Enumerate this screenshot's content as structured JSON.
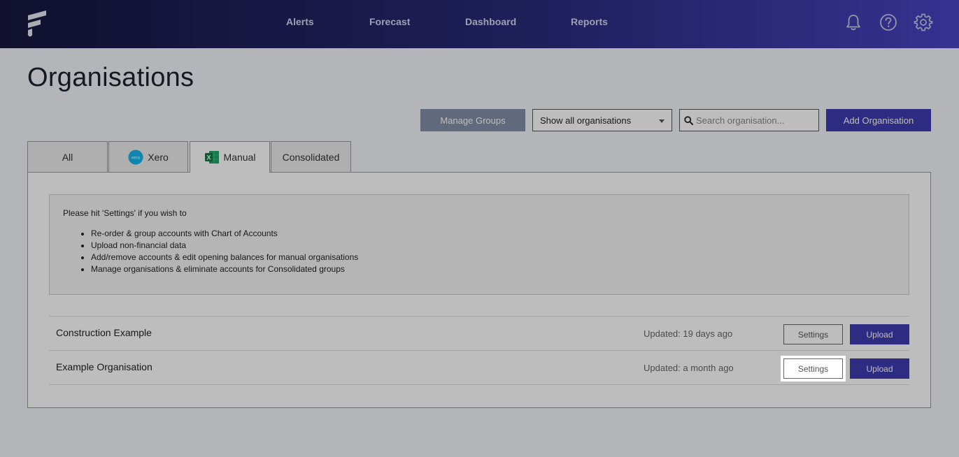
{
  "app": {
    "logo_name": "fathom-logo"
  },
  "nav": {
    "links": [
      "Alerts",
      "Forecast",
      "Dashboard",
      "Reports"
    ],
    "icons": [
      "bell-icon",
      "help-icon",
      "gear-icon"
    ]
  },
  "page": {
    "title": "Organisations"
  },
  "toolbar": {
    "manage_groups": "Manage Groups",
    "filter_selected": "Show all organisations",
    "search_placeholder": "Search organisation...",
    "add_organisation": "Add Organisation"
  },
  "tabs": [
    {
      "label": "All",
      "icon": "",
      "active": false
    },
    {
      "label": "Xero",
      "icon": "xero-icon",
      "active": false
    },
    {
      "label": "Manual",
      "icon": "excel-icon",
      "active": true
    },
    {
      "label": "Consolidated",
      "icon": "",
      "active": false
    }
  ],
  "info": {
    "intro": "Please hit 'Settings' if you wish to",
    "items": [
      "Re-order & group accounts with Chart of Accounts",
      "Upload non-financial data",
      "Add/remove accounts & edit opening balances for manual organisations",
      "Manage organisations & eliminate accounts for Consolidated groups"
    ]
  },
  "organisations": [
    {
      "name": "Construction Example",
      "updated": "Updated: 19 days ago",
      "settings": "Settings",
      "upload": "Upload"
    },
    {
      "name": "Example Organisation",
      "updated": "Updated: a month ago",
      "settings": "Settings",
      "upload": "Upload"
    }
  ],
  "colors": {
    "primary": "#3e3ab0",
    "secondary": "#8390a8",
    "nav_start": "#16163f",
    "nav_end": "#4a44c4"
  }
}
